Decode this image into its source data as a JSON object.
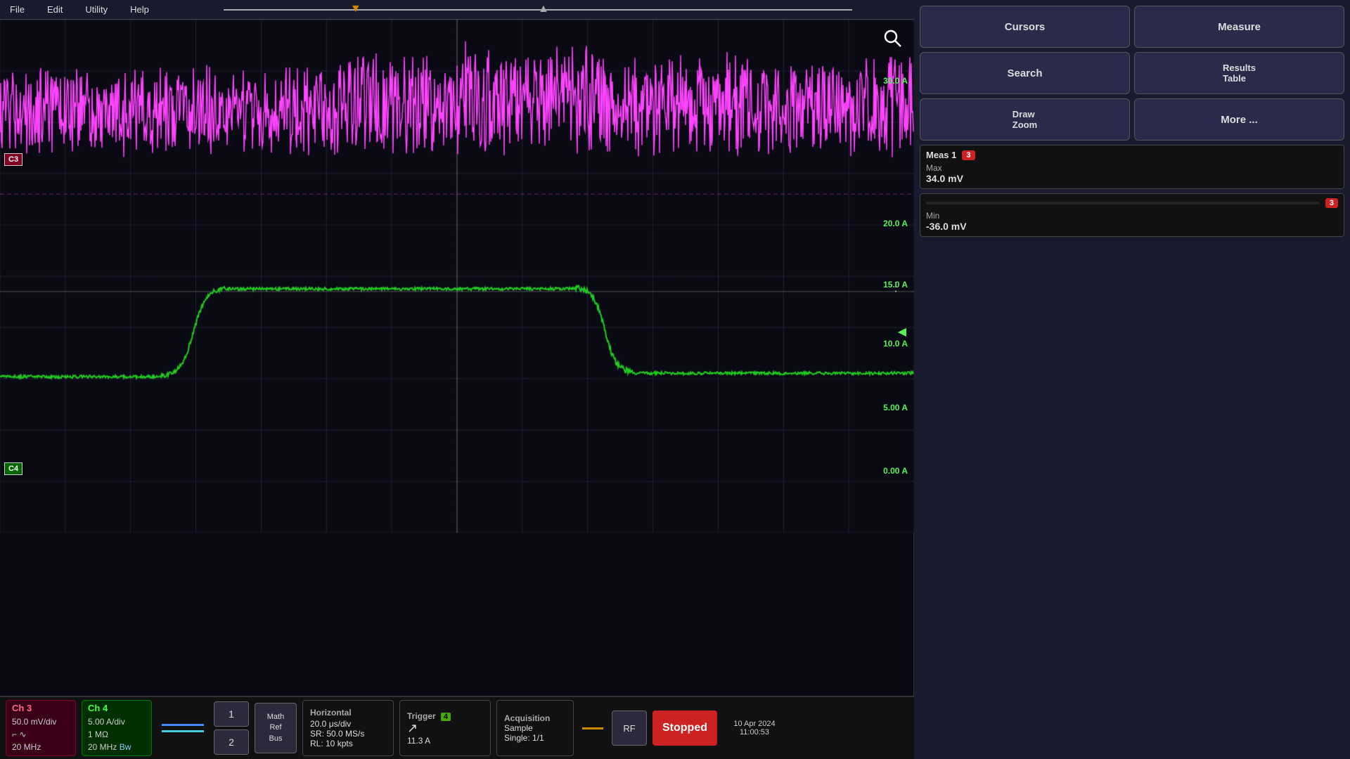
{
  "menu": {
    "items": [
      "File",
      "Edit",
      "Utility",
      "Help"
    ]
  },
  "waveform": {
    "bg_color": "#0a0a14",
    "grid_color": "rgba(80,80,100,0.4)",
    "ch3_color": "#ff44ff",
    "ch4_color": "#22cc22",
    "crosshair_color": "rgba(180,180,180,0.5)"
  },
  "y_labels": {
    "pink": [
      {
        "value": "30.0 A",
        "top_pct": 12
      },
      {
        "value": "20.0 A",
        "top_pct": 40
      },
      {
        "value": "15.0 A",
        "top_pct": 52
      },
      {
        "value": "10.0 A",
        "top_pct": 63
      },
      {
        "value": "5.00 A",
        "top_pct": 75
      },
      {
        "value": "0.00 A",
        "top_pct": 88
      }
    ]
  },
  "channels": {
    "ch3": {
      "label": "C3",
      "scale": "50.0 mV/div",
      "coupling": "DC",
      "impedance": "20 MHz",
      "bw": "Bw"
    },
    "ch4": {
      "label": "C4",
      "scale": "5.00 A/div",
      "impedance": "1 MΩ",
      "bw": "20 MHz",
      "coupling": "Bw"
    }
  },
  "status_bar": {
    "ch3_label": "Ch 3",
    "ch3_scale": "50.0 mV/div",
    "ch3_bw": "20 MHz",
    "ch3_icon1": "⌐",
    "ch3_icon2": "∿",
    "ch4_label": "Ch 4",
    "ch4_scale": "5.00 A/div",
    "ch4_impedance": "1 MΩ",
    "ch4_bw": "20 MHz",
    "ch4_suffix": "Bw",
    "nav_btn1": "1",
    "nav_btn2": "2",
    "math_ref_bus": "Math\nRef\nBus",
    "horizontal_title": "Horizontal",
    "horizontal_time": "20.0 μs/div",
    "horizontal_sr": "SR: 50.0 MS/s",
    "horizontal_rl": "RL: 10 kpts",
    "trigger_title": "Trigger",
    "trigger_ch": "4",
    "trigger_val": "11.3 A",
    "trigger_arrow": "↗",
    "acq_title": "Acquisition",
    "acq_type": "Sample",
    "acq_rate": "Single: 1/1",
    "rf_label": "RF",
    "stopped_label": "Stopped",
    "date": "10 Apr 2024",
    "time": "11:00:53"
  },
  "right_panel": {
    "btn_cursors": "Cursors",
    "btn_measure": "Measure",
    "btn_search": "Search",
    "btn_results_table": "Results\nTable",
    "btn_draw_zoom": "Draw\nZoom",
    "btn_more": "More ...",
    "meas1": {
      "title": "Meas 1",
      "badge": "3",
      "max_label": "Max",
      "max_value": "34.0 mV",
      "min_label": "Min",
      "min_value": "-36.0 mV",
      "badge2": "3"
    },
    "search_icon": "🔍"
  }
}
